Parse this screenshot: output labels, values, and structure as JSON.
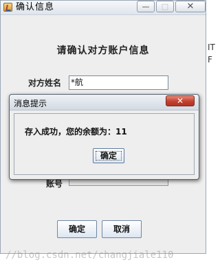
{
  "window": {
    "title": "确认信息",
    "minimize_glyph": "—",
    "maximize_glyph": "□",
    "close_glyph": "✕"
  },
  "form": {
    "heading": "请确认对方账户信息",
    "name_label": "对方姓名",
    "name_value": "*航",
    "account_label": "账号",
    "confirm_label": "确定",
    "cancel_label": "取消"
  },
  "background_window": {
    "chars": [
      "IT",
      "F"
    ]
  },
  "popup": {
    "title": "消息提示",
    "close_glyph": "✕",
    "message": "存入成功，您的余额为：11",
    "ok_label": "确定"
  },
  "watermark": "//blog.csdn.net/changjiale110"
}
